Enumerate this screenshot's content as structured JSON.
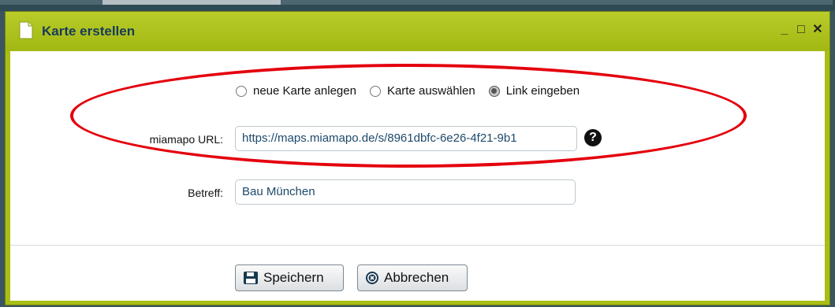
{
  "window": {
    "title": "Karte erstellen",
    "controls": {
      "minimize": "_",
      "maximize": "□",
      "close": "✕"
    }
  },
  "form": {
    "mode_options": [
      {
        "label": "neue Karte anlegen",
        "checked": false
      },
      {
        "label": "Karte auswählen",
        "checked": false
      },
      {
        "label": "Link eingeben",
        "checked": true
      }
    ],
    "url": {
      "label": "miamapo URL:",
      "value": "https://maps.miamapo.de/s/8961dbfc-6e26-4f21-9b1"
    },
    "subject": {
      "label": "Betreff:",
      "value": "Bau München"
    },
    "help_icon": "?"
  },
  "buttons": {
    "save": "Speichern",
    "cancel": "Abbrechen"
  },
  "colors": {
    "titlebar": "#a9be14",
    "title_text": "#173a5a",
    "highlight": "#e4000d"
  },
  "icons": [
    "document-icon",
    "save-disk-icon",
    "cancel-circle-icon",
    "help-icon"
  ]
}
